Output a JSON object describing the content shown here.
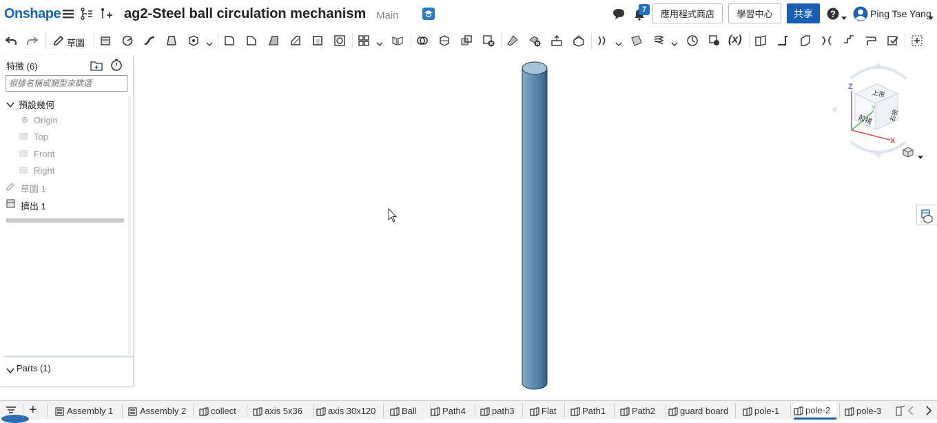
{
  "header": {
    "logo": "Onshape",
    "doc_title": "ag2-Steel ball circulation mechanism",
    "branch": "Main",
    "notification_count": "7",
    "app_store_label": "應用程式商店",
    "learning_label": "學習中心",
    "share_label": "共享",
    "user_name": "Ping Tse Yang"
  },
  "toolbar": {
    "sketch_label": "草圖"
  },
  "features": {
    "title": "特徵 (6)",
    "filter_placeholder": "根據名稱或類型來篩選",
    "default_geometry": "預設幾何",
    "origin": "Origin",
    "top": "Top",
    "front": "Front",
    "right": "Right",
    "sketch1": "草圖 1",
    "extrude1": "擠出 1",
    "parts": "Parts (1)"
  },
  "viewcube": {
    "top": "上視",
    "front": "前視",
    "right": "右視",
    "axis_x": "X",
    "axis_y": "Y",
    "axis_z": "Z"
  },
  "tabs": [
    {
      "label": "Assembly 1",
      "type": "assembly"
    },
    {
      "label": "Assembly 2",
      "type": "assembly"
    },
    {
      "label": "collect",
      "type": "part-studio"
    },
    {
      "label": "axis 5x36",
      "type": "part-studio"
    },
    {
      "label": "axis 30x120",
      "type": "part-studio"
    },
    {
      "label": "Ball",
      "type": "part-studio"
    },
    {
      "label": "Path4",
      "type": "part-studio"
    },
    {
      "label": "path3",
      "type": "part-studio"
    },
    {
      "label": "Flat",
      "type": "part-studio"
    },
    {
      "label": "Path1",
      "type": "part-studio"
    },
    {
      "label": "Path2",
      "type": "part-studio"
    },
    {
      "label": "guard board",
      "type": "part-studio"
    },
    {
      "label": "pole-1",
      "type": "part-studio"
    },
    {
      "label": "pole-2",
      "type": "part-studio",
      "active": true
    },
    {
      "label": "pole-3",
      "type": "part-studio"
    }
  ],
  "colors": {
    "brand": "#1565c0",
    "share_button": "#1a5fb4",
    "cylinder": "#5b8db1",
    "active_tab_underline": "#1a5fb4"
  }
}
